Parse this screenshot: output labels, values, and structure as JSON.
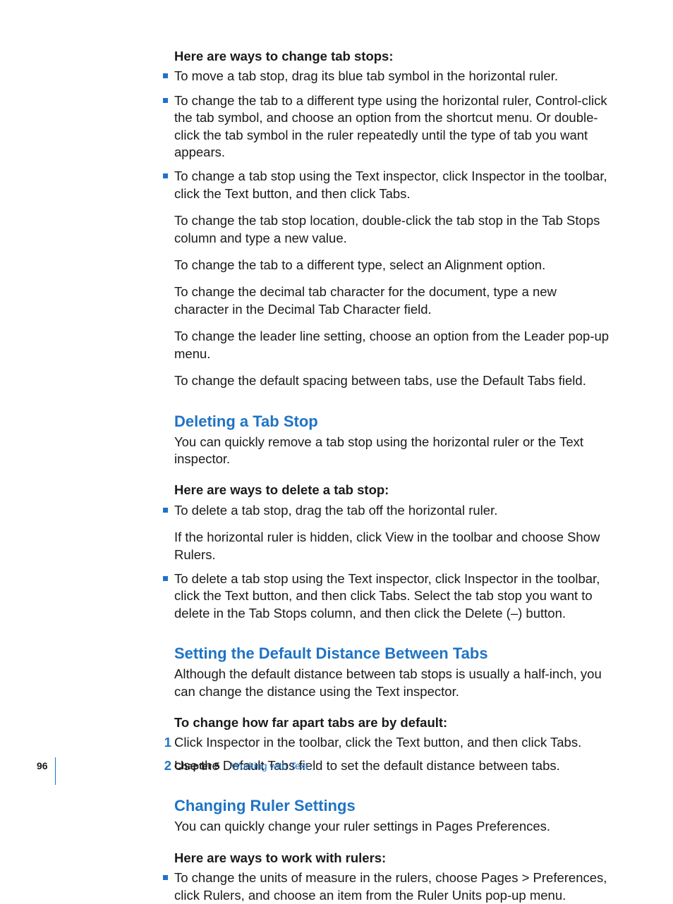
{
  "section1": {
    "lead": "Here are ways to change tab stops:",
    "items": [
      {
        "paras": [
          "To move a tab stop, drag its blue tab symbol in the horizontal ruler."
        ]
      },
      {
        "paras": [
          "To change the tab to a different type using the horizontal ruler, Control-click the tab symbol, and choose an option from the shortcut menu. Or double-click the tab symbol in the ruler repeatedly until the type of tab you want appears."
        ]
      },
      {
        "paras": [
          "To change a tab stop using the Text inspector, click Inspector in the toolbar, click the Text button, and then click Tabs.",
          "To change the tab stop location, double-click the tab stop in the Tab Stops column and type a new value.",
          "To change the tab to a different type, select an Alignment option.",
          "To change the decimal tab character for the document, type a new character in the Decimal Tab Character field.",
          "To change the leader line setting, choose an option from the Leader pop-up menu.",
          "To change the default spacing between tabs, use the Default Tabs field."
        ]
      }
    ]
  },
  "section2": {
    "heading": "Deleting a Tab Stop",
    "intro": "You can quickly remove a tab stop using the horizontal ruler or the Text inspector.",
    "lead": "Here are ways to delete a tab stop:",
    "items": [
      {
        "paras": [
          "To delete a tab stop, drag the tab off the horizontal ruler.",
          "If the horizontal ruler is hidden, click View in the toolbar and choose Show Rulers."
        ]
      },
      {
        "paras": [
          "To delete a tab stop using the Text inspector, click Inspector in the toolbar, click the Text button, and then click Tabs. Select the tab stop you want to delete in the Tab Stops column, and then click the Delete (–) button."
        ]
      }
    ]
  },
  "section3": {
    "heading": "Setting the Default Distance Between Tabs",
    "intro": "Although the default distance between tab stops is usually a half-inch, you can change the distance using the Text inspector.",
    "lead": "To change how far apart tabs are by default:",
    "steps": [
      "Click Inspector in the toolbar, click the Text button, and then click Tabs.",
      "Use the Default Tabs field to set the default distance between tabs."
    ]
  },
  "section4": {
    "heading": "Changing Ruler Settings",
    "intro": "You can quickly change your ruler settings in Pages Preferences.",
    "lead": "Here are ways to work with rulers:",
    "items": [
      {
        "paras": [
          "To change the units of measure in the rulers, choose Pages > Preferences, click Rulers, and choose an item from the Ruler Units pop-up menu."
        ]
      }
    ]
  },
  "footer": {
    "page": "96",
    "chapterLabel": "Chapter 5",
    "chapterTitle": "Working with Text"
  }
}
